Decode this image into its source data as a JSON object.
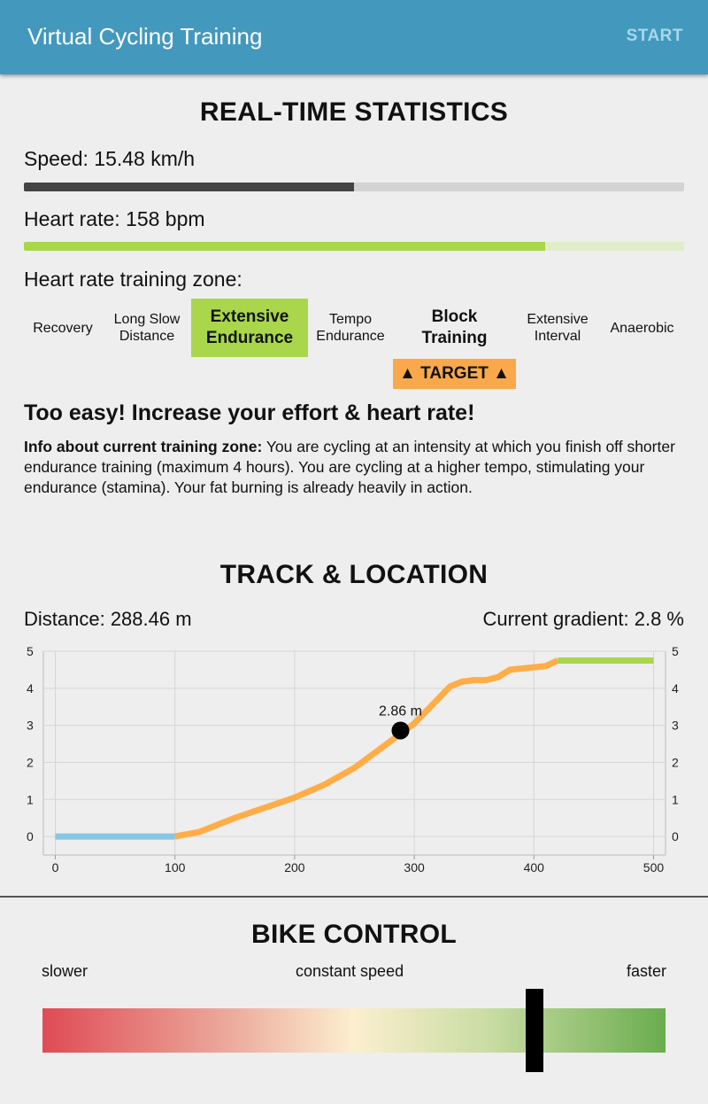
{
  "appbar": {
    "title": "Virtual Cycling Training",
    "start_label": "START"
  },
  "stats": {
    "section_title": "REAL-TIME STATISTICS",
    "speed_label": "Speed: 15.48 km/h",
    "speed_fraction": 0.5,
    "heart_rate_label": "Heart rate: 158 bpm",
    "heart_rate_fraction": 0.79,
    "zone_label": "Heart rate training zone:",
    "zones": [
      {
        "label": "Recovery"
      },
      {
        "label": "Long Slow\nDistance"
      },
      {
        "label": "Extensive\nEndurance",
        "state": "current"
      },
      {
        "label": "Tempo\nEndurance"
      },
      {
        "label": "Block\nTraining",
        "state": "target"
      },
      {
        "label": "Extensive\nInterval"
      },
      {
        "label": "Anaerobic"
      }
    ],
    "target_badge": "▲ TARGET ▲",
    "feedback": "Too easy! Increase your effort & heart rate!",
    "info_prefix": "Info about current training zone:",
    "info_text": " You are cycling at an intensity at which you finish off shorter endurance training (maximum 4 hours). You are cycling at a higher tempo, stimulating your endurance (stamina). Your fat burning is already heavily in action."
  },
  "track": {
    "section_title": "TRACK & LOCATION",
    "distance_label": "Distance: 288.46 m",
    "gradient_label": "Current gradient: 2.8 %"
  },
  "chart_data": {
    "type": "line",
    "x_ticks": [
      "0",
      "100",
      "200",
      "300",
      "400",
      "500"
    ],
    "y_ticks_left": [
      "0",
      "1",
      "2",
      "3",
      "4",
      "5"
    ],
    "y_ticks_right": [
      "0",
      "1",
      "2",
      "3",
      "4",
      "5"
    ],
    "xlim": [
      -10,
      510
    ],
    "ylim": [
      -0.5,
      5
    ],
    "grid": true,
    "series": [
      {
        "color": "#87c5e3",
        "x": [
          0,
          100
        ],
        "y": [
          0,
          0
        ]
      },
      {
        "color": "#ffad47",
        "x": [
          100,
          120,
          150,
          200,
          225,
          250,
          275,
          300,
          315,
          330,
          340,
          350,
          360,
          370,
          380,
          395,
          410,
          420
        ],
        "y": [
          0,
          0.12,
          0.5,
          1.05,
          1.4,
          1.85,
          2.45,
          3.05,
          3.55,
          4.05,
          4.18,
          4.22,
          4.22,
          4.3,
          4.5,
          4.55,
          4.6,
          4.75
        ]
      },
      {
        "color": "#a9d64a",
        "x": [
          420,
          500
        ],
        "y": [
          4.75,
          4.75
        ]
      }
    ],
    "marker": {
      "x": 288.46,
      "y": 2.86,
      "label": "2.86 m"
    }
  },
  "bike_control": {
    "section_title": "BIKE CONTROL",
    "slower_label": "slower",
    "constant_label": "constant speed",
    "faster_label": "faster",
    "slider_fraction": 0.79
  }
}
